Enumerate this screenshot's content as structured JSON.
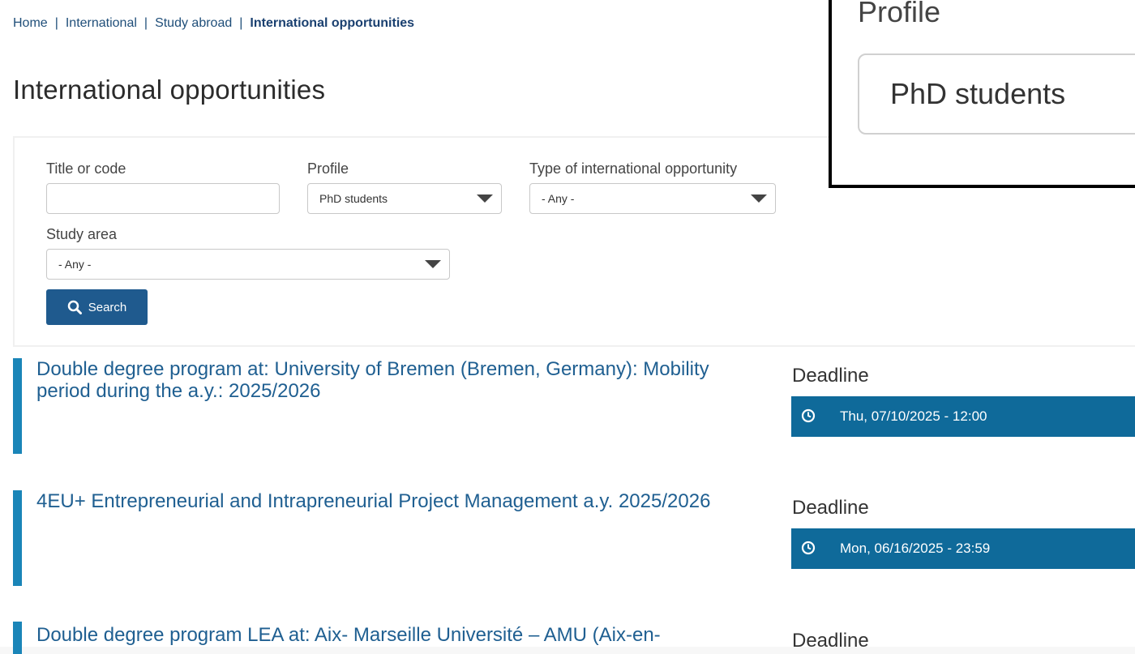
{
  "breadcrumb": {
    "items": [
      "Home",
      "International",
      "Study abroad"
    ],
    "current": "International opportunities",
    "separator": "|"
  },
  "page_title": "International opportunities",
  "filters": {
    "title_label": "Title or code",
    "title_value": "",
    "profile_label": "Profile",
    "profile_value": "PhD students",
    "type_label": "Type of international opportunity",
    "type_value": "- Any -",
    "study_area_label": "Study area",
    "study_area_value": "- Any -",
    "search_label": "Search"
  },
  "results": [
    {
      "title": "Double degree program at: University of Bremen (Bremen, Germany): Mobility period during the a.y.: 2025/2026",
      "deadline_label": "Deadline",
      "deadline": "Thu, 07/10/2025 - 12:00"
    },
    {
      "title": "4EU+ Entrepreneurial and Intrapreneurial Project Management a.y. 2025/2026",
      "deadline_label": "Deadline",
      "deadline": "Mon, 06/16/2025 - 23:59"
    },
    {
      "title": "Double degree program LEA at: Aix- Marseille Université – AMU (Aix-en-",
      "deadline_label": "Deadline"
    }
  ],
  "zoom": {
    "label": "Profile",
    "value": "PhD students"
  },
  "colors": {
    "link": "#1f5f91",
    "accent_bar": "#1a85b8",
    "deadline_bg": "#0f6a9a",
    "button_bg": "#1f5a8e"
  }
}
